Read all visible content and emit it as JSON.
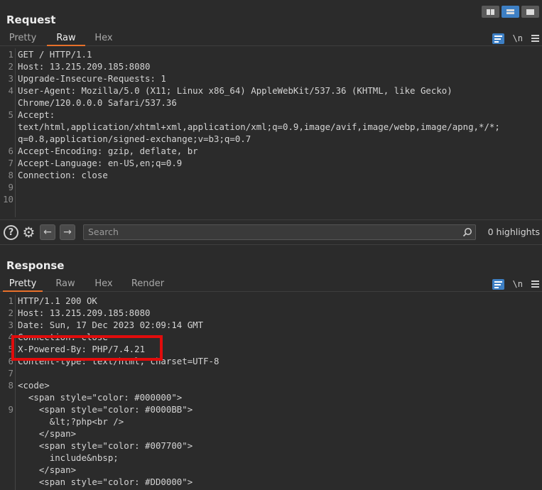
{
  "request": {
    "title": "Request",
    "tabs": [
      "Pretty",
      "Raw",
      "Hex"
    ],
    "active_tab": "Raw",
    "lines": [
      {
        "n": "1",
        "text": "GET / HTTP/1.1"
      },
      {
        "n": "2",
        "text": "Host: 13.215.209.185:8080"
      },
      {
        "n": "3",
        "text": "Upgrade-Insecure-Requests: 1"
      },
      {
        "n": "4",
        "text": "User-Agent: Mozilla/5.0 (X11; Linux x86_64) AppleWebKit/537.36 (KHTML, like Gecko)"
      },
      {
        "n": "",
        "text": "Chrome/120.0.0.0 Safari/537.36"
      },
      {
        "n": "5",
        "text": "Accept:"
      },
      {
        "n": "",
        "text": "text/html,application/xhtml+xml,application/xml;q=0.9,image/avif,image/webp,image/apng,*/*;"
      },
      {
        "n": "",
        "text": "q=0.8,application/signed-exchange;v=b3;q=0.7"
      },
      {
        "n": "6",
        "text": "Accept-Encoding: gzip, deflate, br"
      },
      {
        "n": "7",
        "text": "Accept-Language: en-US,en;q=0.9"
      },
      {
        "n": "8",
        "text": "Connection: close"
      },
      {
        "n": "9",
        "text": ""
      },
      {
        "n": "10",
        "text": ""
      }
    ]
  },
  "search": {
    "placeholder": "Search",
    "highlights": "0 highlights"
  },
  "response": {
    "title": "Response",
    "tabs": [
      "Pretty",
      "Raw",
      "Hex",
      "Render"
    ],
    "active_tab": "Pretty",
    "lines": [
      {
        "n": "1",
        "text": "HTTP/1.1 200 OK"
      },
      {
        "n": "2",
        "text": "Host: 13.215.209.185:8080"
      },
      {
        "n": "3",
        "text": "Date: Sun, 17 Dec 2023 02:09:14 GMT"
      },
      {
        "n": "4",
        "text": "Connection: close"
      },
      {
        "n": "5",
        "text": "X-Powered-By: PHP/7.4.21"
      },
      {
        "n": "6",
        "text": "Content-type: text/html; charset=UTF-8"
      },
      {
        "n": "7",
        "text": ""
      },
      {
        "n": "8",
        "text": "<code>"
      },
      {
        "n": "",
        "text": "  <span style=\"color: #000000\">"
      },
      {
        "n": "9",
        "text": "    <span style=\"color: #0000BB\">"
      },
      {
        "n": "",
        "text": "      &lt;?php<br />"
      },
      {
        "n": "",
        "text": "    </span>"
      },
      {
        "n": "",
        "text": "    <span style=\"color: #007700\">"
      },
      {
        "n": "",
        "text": "      include&nbsp;"
      },
      {
        "n": "",
        "text": "    </span>"
      },
      {
        "n": "",
        "text": "    <span style=\"color: #DD0000\">"
      }
    ]
  },
  "colors": {
    "accent_tab": "#e8702a",
    "accent_blue": "#3d7fc4",
    "highlight_box": "#e10c0c"
  }
}
